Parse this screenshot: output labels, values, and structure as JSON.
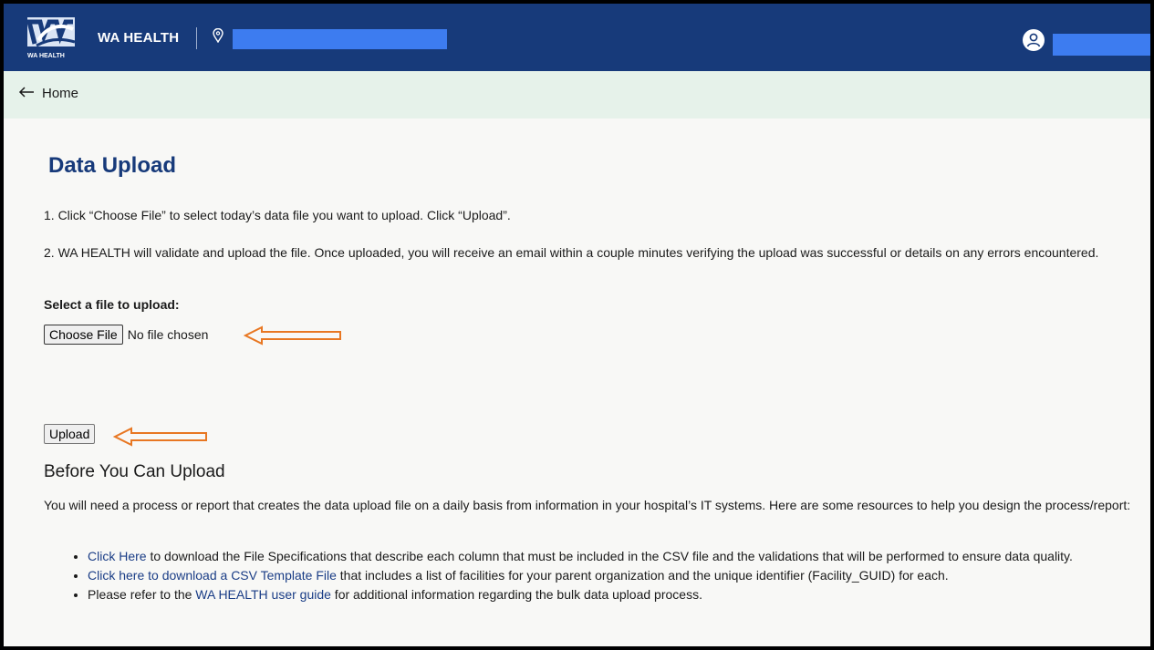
{
  "header": {
    "brand": "WA HEALTH",
    "logo_caption": "WA HEALTH",
    "brand_color": "#173a7a",
    "location_icon": "map-pin-icon",
    "user_icon": "user-icon"
  },
  "breadcrumb": {
    "back_label": "Home",
    "back_icon": "arrow-left-icon"
  },
  "page": {
    "title": "Data Upload",
    "step1": "1. Click “Choose File” to select today’s data file you want to upload. Click “Upload”.",
    "step2": "2. WA HEALTH will validate and upload the file. Once uploaded, you will receive an email within a couple minutes verifying the upload was successful or details on any errors encountered.",
    "select_label": "Select a file to upload:",
    "choose_file_label": "Choose File",
    "no_file_text": "No file chosen",
    "upload_label": "Upload",
    "annotation_color": "#e87722"
  },
  "before": {
    "heading": "Before You Can Upload",
    "intro": "You will need a process or report that creates the data upload file on a daily basis from information in your hospital’s IT systems. Here are some resources to help you design the process/report:",
    "items": [
      {
        "link": "Click Here",
        "text": " to download the File Specifications that describe each column that must be included in the CSV file and the validations that will be performed to ensure data quality."
      },
      {
        "link": "Click here to download a CSV Template File",
        "text": " that includes a list of facilities for your parent organization and the unique identifier (Facility_GUID) for each."
      },
      {
        "prefix": "Please refer to the ",
        "link": "WA HEALTH user guide",
        "text": " for additional information regarding the bulk data upload process."
      }
    ]
  }
}
